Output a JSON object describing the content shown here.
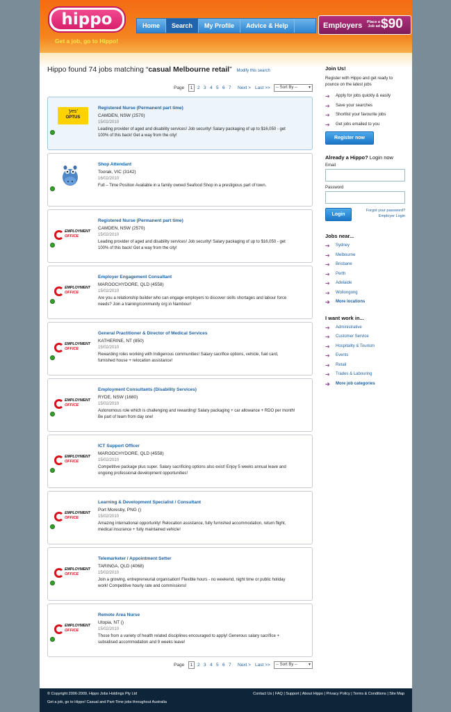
{
  "header": {
    "logo_text": "hippo",
    "tagline": "Get a job, go to Hippo!",
    "nav": [
      "Home",
      "Search",
      "My Profile",
      "Advice & Help"
    ],
    "nav_active": "Search",
    "employers": {
      "label": "Employers",
      "place_text": "Place a Job ad",
      "price": "$90"
    }
  },
  "results": {
    "prefix": "Hippo found 74 jobs matching “",
    "query": "casual Melbourne retail",
    "suffix": "”",
    "modify_link": "Modify this search"
  },
  "pager": {
    "label": "Page",
    "current": "1",
    "pages": [
      "2",
      "3",
      "4",
      "5",
      "6",
      "7"
    ],
    "next": "Next >",
    "last": "Last >>",
    "sort": "-- Sort By --"
  },
  "listings": [
    {
      "logo": "optus",
      "title": "Registered Nurse (Permanent part time)",
      "location": "CAMDEN, NSW (2570)",
      "date": "15/02/2010",
      "desc": "Leading provider of aged and disability services! Job security! Salary packaging of up to $16,050 - get 100% of this back! Get a way from the city!",
      "highlight": true
    },
    {
      "logo": "mascot",
      "title": "Shop Attendant",
      "location": "Toorak, VIC (3142)",
      "date": "16/02/2010",
      "desc": "Full – Time Position Available in a family owned Seafood Shop in a prestigious part of town.",
      "highlight": false
    },
    {
      "logo": "employment-office",
      "title": "Registered Nurse (Permanent part time)",
      "location": "CAMDEN, NSW (2570)",
      "date": "15/02/2010",
      "desc": "Leading provider of aged and disability services! Job security! Salary packaging of up to $16,050 - get 100% of this back! Get a way from the city!",
      "highlight": false
    },
    {
      "logo": "employment-office",
      "title": "Employer Engagement Consultant",
      "location": "MAROOCHYDORE, QLD (4558)",
      "date": "15/02/2010",
      "desc": "Are you a relationship builder who can engage employers to discover skills shortages and labour force needs? Join a training/community org in Nambour!",
      "highlight": false
    },
    {
      "logo": "employment-office",
      "title": "General Practitioner & Director of Medical Services",
      "location": "KATHERINE, NT (850)",
      "date": "15/02/2010",
      "desc": "Rewarding roles working with Indigenous communities! Salary sacrifice options, vehicle, fuel card, furnished house + relocation assistance!",
      "highlight": false
    },
    {
      "logo": "employment-office",
      "title": "Employment Consultants (Disability Services)",
      "location": "RYDE, NSW (1680)",
      "date": "15/02/2010",
      "desc": "Autonomous role which is challenging and rewarding! Salary packaging + car allowance + RDO per month! Be part of team from day one!",
      "highlight": false
    },
    {
      "logo": "employment-office",
      "title": "ICT Support Officer",
      "location": "MAROOCHYDORE, QLD (4558)",
      "date": "15/02/2010",
      "desc": "Competitive package plus super. Salary sacrificing options also exist! Enjoy 5 weeks annual leave and ongoing professional development opportunities!",
      "highlight": false
    },
    {
      "logo": "employment-office",
      "title": "Learning & Development Specialist / Consultant",
      "location": "Port Moresby, PNG ()",
      "date": "15/02/2010",
      "desc": "Amazing international opportunity! Relocation assistance, fully furnished accommodation, return flight, medical insurance + fully maintained vehicle!",
      "highlight": false
    },
    {
      "logo": "employment-office",
      "title": "Telemarketer / Appointment Setter",
      "location": "TARINGA, QLD (4068)",
      "date": "15/02/2010",
      "desc": "Join a growing, entrepreneurial organisation! Flexible hours - no weekend, night time or public holiday work! Competitive hourly rate and commissions!",
      "highlight": false
    },
    {
      "logo": "employment-office",
      "title": "Remote Area Nurse",
      "location": "Utopia, NT ()",
      "date": "15/02/2010",
      "desc": "Those from a variety of health related disciplines encouraged to apply! Generous salary sacrifice + subsidised accommodation and 9 weeks leave!",
      "highlight": false
    }
  ],
  "employment_office": {
    "line1": "EMPLOYMENT",
    "line2": "OFFICE"
  },
  "optus_logo": {
    "line1": "'yes'",
    "line2": "OPTUS"
  },
  "sidebar": {
    "join": {
      "heading": "Join Us!",
      "text": "Register with Hippo and get ready to pounce on the latest jobs",
      "benefits": [
        "Apply for jobs quickly & easily",
        "Save your searches",
        "Shortlist your favourite jobs",
        "Get jobs emailed to you"
      ],
      "register_button": "Register now"
    },
    "login": {
      "heading_bold": "Already a Hippo?",
      "heading_rest": " Login now",
      "email_label": "Email",
      "password_label": "Password",
      "login_button": "Login",
      "forgot": "Forgot your password?",
      "employer_login": "Employer Login"
    },
    "jobs_near": {
      "heading": "Jobs near...",
      "items": [
        "Sydney",
        "Melbourne",
        "Brisbane",
        "Perth",
        "Adelaide",
        "Wollongong"
      ],
      "more": "More locations"
    },
    "work_in": {
      "heading": "I want work in...",
      "items": [
        "Administrative",
        "Customer Service",
        "Hospitality & Tourism",
        "Events",
        "Retail",
        "Trades & Labouring"
      ],
      "more": "More job categories"
    }
  },
  "footer": {
    "copyright": "© Copyright 2006-2009, Hippo Jobs Holdings Pty Ltd",
    "tagline": "Get a job, go to Hippo! Casual and Part-Time jobs throughout Australia",
    "links": "Contact Us  |  FAQ  |  Support  |  About Hippo  |  Privacy Policy  |  Terms & Conditions  |  Site Map"
  },
  "colors": {
    "brand_orange": "#f46c12",
    "brand_pink": "#d81f6c",
    "link_blue": "#1c5fa0",
    "footer_bg": "#0e2539"
  }
}
